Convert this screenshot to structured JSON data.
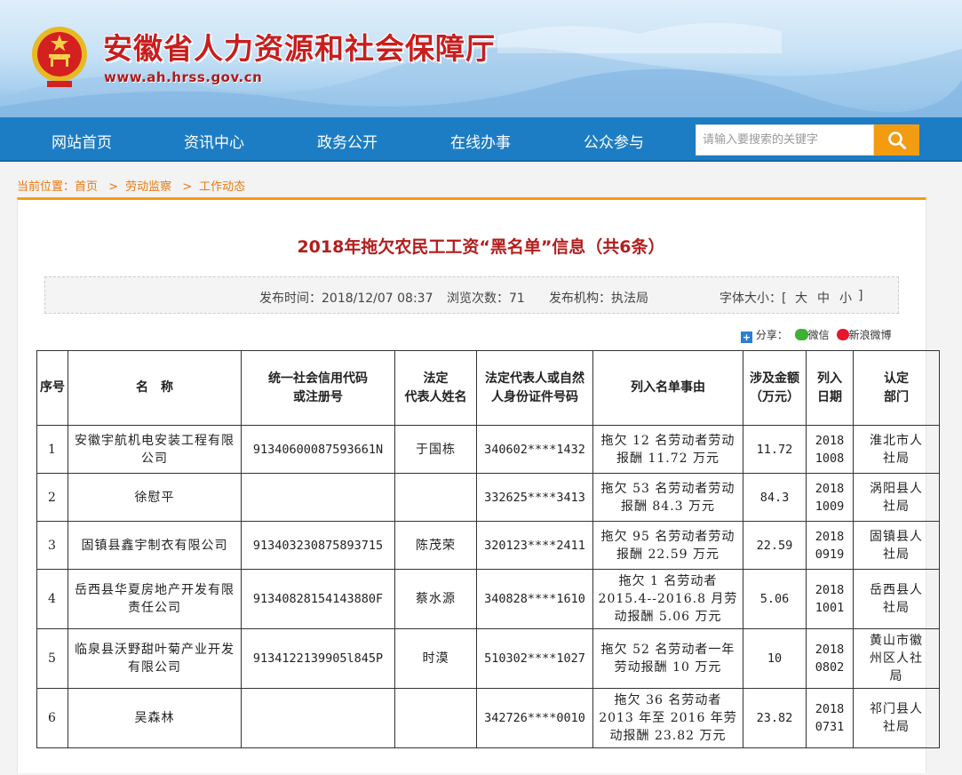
{
  "site": {
    "title": "安徽省人力资源和社会保障厅",
    "url": "www.ah.hrss.gov.cn"
  },
  "nav": {
    "items": [
      "网站首页",
      "资讯中心",
      "政务公开",
      "在线办事",
      "公众参与"
    ],
    "search_placeholder": "请输入要搜索的关键字"
  },
  "breadcrumb": {
    "prefix": "当前位置：",
    "items": [
      "首页",
      "劳动监察",
      "工作动态"
    ],
    "separator": ">"
  },
  "article": {
    "title": "2018年拖欠农民工工资“黑名单”信息（共6条）",
    "publish_time": "发布时间：2018/12/07 08:37",
    "views": "浏览次数：71",
    "publisher": "发布机构：执法局",
    "font_size_label": "字体大小：[",
    "font_large": "大",
    "font_medium": "中",
    "font_small": "小",
    "font_close": "]"
  },
  "share": {
    "label": "分享：",
    "wechat": "微信",
    "weibo": "新浪微博"
  },
  "table": {
    "headers": {
      "seq": "序号",
      "name": "名　称",
      "credit_1": "统一社会信用代码",
      "credit_2": "或注册号",
      "rep_1": "法定",
      "rep_2": "代表人姓名",
      "id_1": "法定代表人或自然",
      "id_2": "人身份证件号码",
      "reason": "列入名单事由",
      "amount_1": "涉及金额",
      "amount_2": "（万元）",
      "date_1": "列入",
      "date_2": "日期",
      "dept_1": "认定",
      "dept_2": "部门"
    },
    "rows": [
      {
        "seq": "1",
        "name": "安徽宇航机电安装工程有限公司",
        "credit": "91340600087593661N",
        "rep": "于国栋",
        "id": "340602****1432",
        "reason": "拖欠 12 名劳动者劳动报酬 11.72 万元",
        "amount": "11.72",
        "date": "2018 1008",
        "dept": "淮北市人社局"
      },
      {
        "seq": "2",
        "name": "徐慰平",
        "credit": "",
        "rep": "",
        "id": "332625****3413",
        "reason": "拖欠 53 名劳动者劳动报酬 84.3 万元",
        "amount": "84.3",
        "date": "2018 1009",
        "dept": "涡阳县人社局"
      },
      {
        "seq": "3",
        "name": "固镇县鑫宇制衣有限公司",
        "credit": "913403230875893715",
        "rep": "陈茂荣",
        "id": "320123****2411",
        "reason": "拖欠 95 名劳动者劳动报酬 22.59 万元",
        "amount": "22.59",
        "date": "2018 0919",
        "dept": "固镇县人社局"
      },
      {
        "seq": "4",
        "name": "岳西县华夏房地产开发有限责任公司",
        "credit": "91340828154143880F",
        "rep": "蔡水源",
        "id": "340828****1610",
        "reason": "拖欠 1 名劳动者 2015.4--2016.8 月劳动报酬 5.06 万元",
        "amount": "5.06",
        "date": "2018 1001",
        "dept": "岳西县人社局"
      },
      {
        "seq": "5",
        "name": "临泉县沃野甜叶菊产业开发有限公司",
        "credit": "9134122139905l845P",
        "rep": "时漠",
        "id": "510302****1027",
        "reason": "拖欠 52 名劳动者一年劳动报酬 10 万元",
        "amount": "10",
        "date": "2018 0802",
        "dept": "黄山市徽州区人社局"
      },
      {
        "seq": "6",
        "name": "吴森林",
        "credit": "",
        "rep": "",
        "id": "342726****0010",
        "reason": "拖欠 36 名劳动者 2013 年至 2016 年劳动报酬 23.82 万元",
        "amount": "23.82",
        "date": "2018 0731",
        "dept": "祁门县人社局"
      }
    ]
  }
}
